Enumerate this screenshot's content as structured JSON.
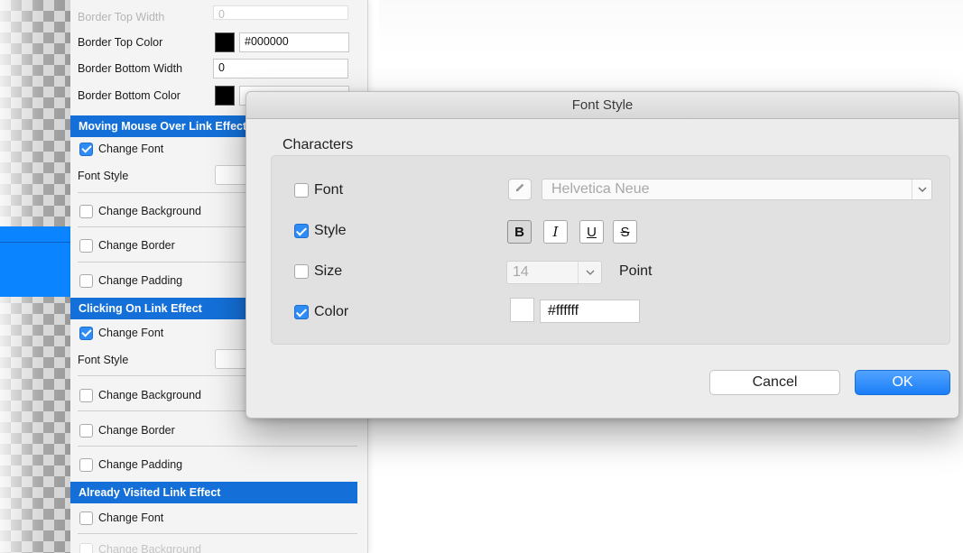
{
  "panel": {
    "rows": [
      {
        "label": "Border Top Width",
        "value": "0"
      },
      {
        "label": "Border Top Color",
        "value": "#000000"
      },
      {
        "label": "Border Bottom Width",
        "value": "0"
      },
      {
        "label": "Border Bottom Color",
        "value": ""
      }
    ],
    "sections": {
      "hover": "Moving Mouse Over Link Effect",
      "click": "Clicking On Link Effect",
      "visited": "Already Visited Link Effect"
    },
    "hover_items": {
      "change_font": "Change Font",
      "font_style": "Font Style",
      "change_background": "Change Background",
      "change_border": "Change Border",
      "change_padding": "Change Padding"
    },
    "click_items": {
      "change_font": "Change Font",
      "font_style": "Font Style",
      "change_background": "Change Background",
      "change_border": "Change Border",
      "change_padding": "Change Padding"
    },
    "visited_items": {
      "change_font": "Change Font",
      "change_background": "Change Background"
    }
  },
  "dialog": {
    "title": "Font Style",
    "group_title": "Characters",
    "font_label": "Font",
    "font_value": "Helvetica Neue",
    "style_label": "Style",
    "style_buttons": {
      "bold": "B",
      "italic": "I",
      "underline": "U",
      "strike": "S"
    },
    "size_label": "Size",
    "size_value": "14",
    "size_unit": "Point",
    "color_label": "Color",
    "color_value": "#ffffff",
    "cancel": "Cancel",
    "ok": "OK"
  },
  "colors": {
    "section_header": "#1470d8",
    "accent": "#2f8cf5",
    "ok_button": "#1a7ef7"
  }
}
